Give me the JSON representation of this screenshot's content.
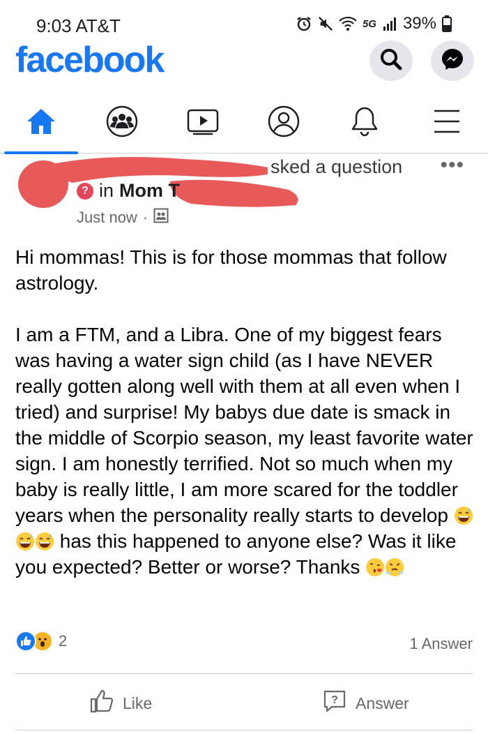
{
  "status_bar": {
    "time_carrier": "9:03 AT&T",
    "network": "5G",
    "battery": "39%",
    "icons": [
      "alarm-icon",
      "mute-icon",
      "wifi-icon",
      "signal-icon",
      "battery-icon"
    ]
  },
  "header": {
    "logo": "facebook",
    "brand_color": "#1877f2",
    "icons": [
      "search-icon",
      "messenger-icon"
    ]
  },
  "nav": {
    "tabs": [
      "home",
      "groups",
      "watch",
      "profile",
      "notifications",
      "menu"
    ],
    "active_tab": "home"
  },
  "post": {
    "asked_label": "sked a question",
    "in_label": "in",
    "group_name": "Mom T",
    "timestamp": "Just now",
    "separator": "·",
    "more_label": "•••",
    "paragraph1": "Hi mommas! This is for those mommas that follow astrology.",
    "paragraph2": "I am a FTM, and a Libra. One of my biggest fears was having a water sign child (as I have NEVER really gotten along well with them at all even when I tried) and surprise! My babys due date is smack in the middle of Scorpio season, my least favorite water sign. I am honestly terrified. Not so much when my baby is really little, I am more scared for the toddler years when the personality really starts to develop",
    "paragraph2_tail": " has this happened to anyone else? Was it like you expected? Better or worse? Thanks ",
    "reaction_count": "2",
    "answer_count": "1 Answer"
  },
  "actions": {
    "like_label": "Like",
    "answer_label": "Answer"
  }
}
